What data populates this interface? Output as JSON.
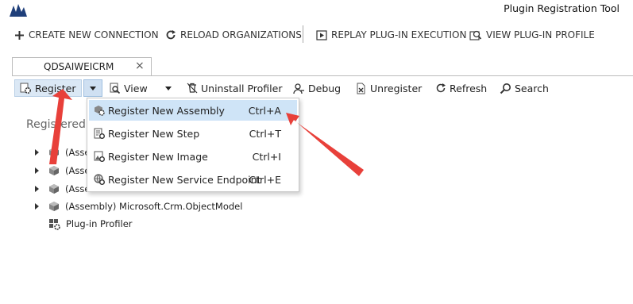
{
  "app": {
    "title": "Plugin Registration Tool",
    "logo_icon": "dynamics-logo-icon"
  },
  "commands": [
    {
      "label": "CREATE NEW CONNECTION",
      "icon": "plus-icon"
    },
    {
      "label": "RELOAD ORGANIZATIONS",
      "icon": "refresh-icon"
    },
    {
      "label": "REPLAY PLUG-IN EXECUTION",
      "icon": "replay-icon"
    },
    {
      "label": "VIEW PLUG-IN PROFILE",
      "icon": "profile-icon"
    }
  ],
  "tab": {
    "label": "QDSAIWEICRM",
    "close": "×"
  },
  "toolbar": {
    "register": "Register",
    "view": "View",
    "uninstall_profiler": "Uninstall Profiler",
    "debug": "Debug",
    "unregister": "Unregister",
    "refresh": "Refresh",
    "search": "Search"
  },
  "tree": {
    "title": "Registered",
    "items": [
      {
        "label": "(Asse",
        "icon": "assembly-icon"
      },
      {
        "label": "(Asse",
        "icon": "assembly-icon"
      },
      {
        "label": "(Asse",
        "icon": "assembly-icon"
      },
      {
        "label": "(Assembly) Microsoft.Crm.ObjectModel",
        "icon": "assembly-icon"
      },
      {
        "label": "Plug-in Profiler",
        "icon": "profiler-icon"
      }
    ]
  },
  "register_menu": [
    {
      "label": "Register New Assembly",
      "shortcut": "Ctrl+A",
      "icon": "gear-cube-icon"
    },
    {
      "label": "Register New Step",
      "shortcut": "Ctrl+T",
      "icon": "step-icon"
    },
    {
      "label": "Register New Image",
      "shortcut": "Ctrl+I",
      "icon": "image-icon"
    },
    {
      "label": "Register New Service Endpoint",
      "shortcut": "Ctrl+E",
      "icon": "endpoint-icon"
    }
  ],
  "colors": {
    "highlight": "#cfe4f7",
    "register_button_bg": "#dbe8f5",
    "annotation_arrow": "#e8403a"
  }
}
